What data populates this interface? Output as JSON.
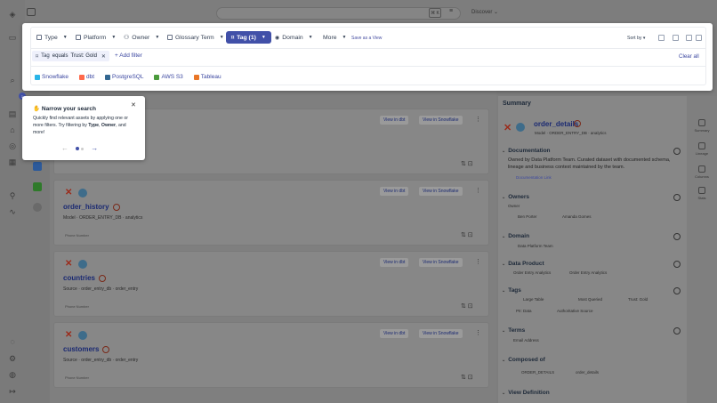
{
  "topbar": {
    "kbd": "⌘ K",
    "discover_label": "Discover"
  },
  "filters": {
    "type_label": "Type",
    "platform_label": "Platform",
    "owner_label": "Owner",
    "glossary_label": "Glossary Term",
    "tag_label": "Tag (1)",
    "domain_label": "Domain",
    "more_label": "More",
    "save_view_label": "Save as a View",
    "sort_label": "Sort by",
    "active_tag": {
      "field": "Tag",
      "operator": "equals",
      "value": "Trust: Gold"
    },
    "add_filter_label": "Add filter",
    "clear_all_label": "Clear all",
    "sources": [
      "Snowflake",
      "dbt",
      "PostgreSQL",
      "AWS S3",
      "Tableau"
    ]
  },
  "tooltip": {
    "step": "1",
    "title": "Narrow your search",
    "body_prefix": "Quickly find relevant assets by applying one or more filters. Try filtering by",
    "body_type": "Type",
    "body_owner": "Owner",
    "body_suffix": ", and more!"
  },
  "results": [
    {
      "title": "",
      "sub": "",
      "dbt": "View in dbt",
      "snow": "View in Snowflake"
    },
    {
      "title": "order_history",
      "sub": "Model · ORDER_ENTRY_DB · analytics",
      "dbt": "View in dbt",
      "snow": "View in Snowflake",
      "foot": "Phone Number"
    },
    {
      "title": "countries",
      "sub": "Source · order_entry_db · order_entry",
      "dbt": "View in dbt",
      "snow": "View in Snowflake",
      "foot": "Phone Number"
    },
    {
      "title": "customers",
      "sub": "Source · order_entry_db · order_entry",
      "dbt": "View in dbt",
      "snow": "View in Snowflake",
      "foot": "Phone Number"
    }
  ],
  "summary": {
    "header": "Summary",
    "entity_title": "order_details",
    "entity_sub": "Model · ORDER_ENTRY_DB · analytics",
    "documentation_label": "Documentation",
    "documentation_text": "Owned by Data Platform Team. Curated dataset with documented schema, lineage and business context maintained by the team.",
    "documentation_link": "Documentation Link",
    "owners_label": "Owners",
    "owners_role": "Owner",
    "owner_1": "Ben Porter",
    "owner_2": "Amanda Gomes",
    "domain_label": "Domain",
    "domain_value": "Data Platform Team",
    "data_product_label": "Data Product",
    "data_product_1": "Order Entry Analytics",
    "data_product_2": "Order Entry Analytics",
    "tags_label": "Tags",
    "tag_1": "Large Table",
    "tag_2": "Most Queried",
    "tag_3": "Trust: Gold",
    "tag_4": "PII: Data",
    "tag_5": "Authoritative Source",
    "terms_label": "Terms",
    "term_1": "Email Address",
    "composed_label": "Composed of",
    "composed_1": "ORDER_DETAILS",
    "composed_2": "order_details",
    "view_def_label": "View Definition"
  },
  "right_tabs": [
    "Summary",
    "Lineage",
    "Columns",
    "Stats"
  ]
}
